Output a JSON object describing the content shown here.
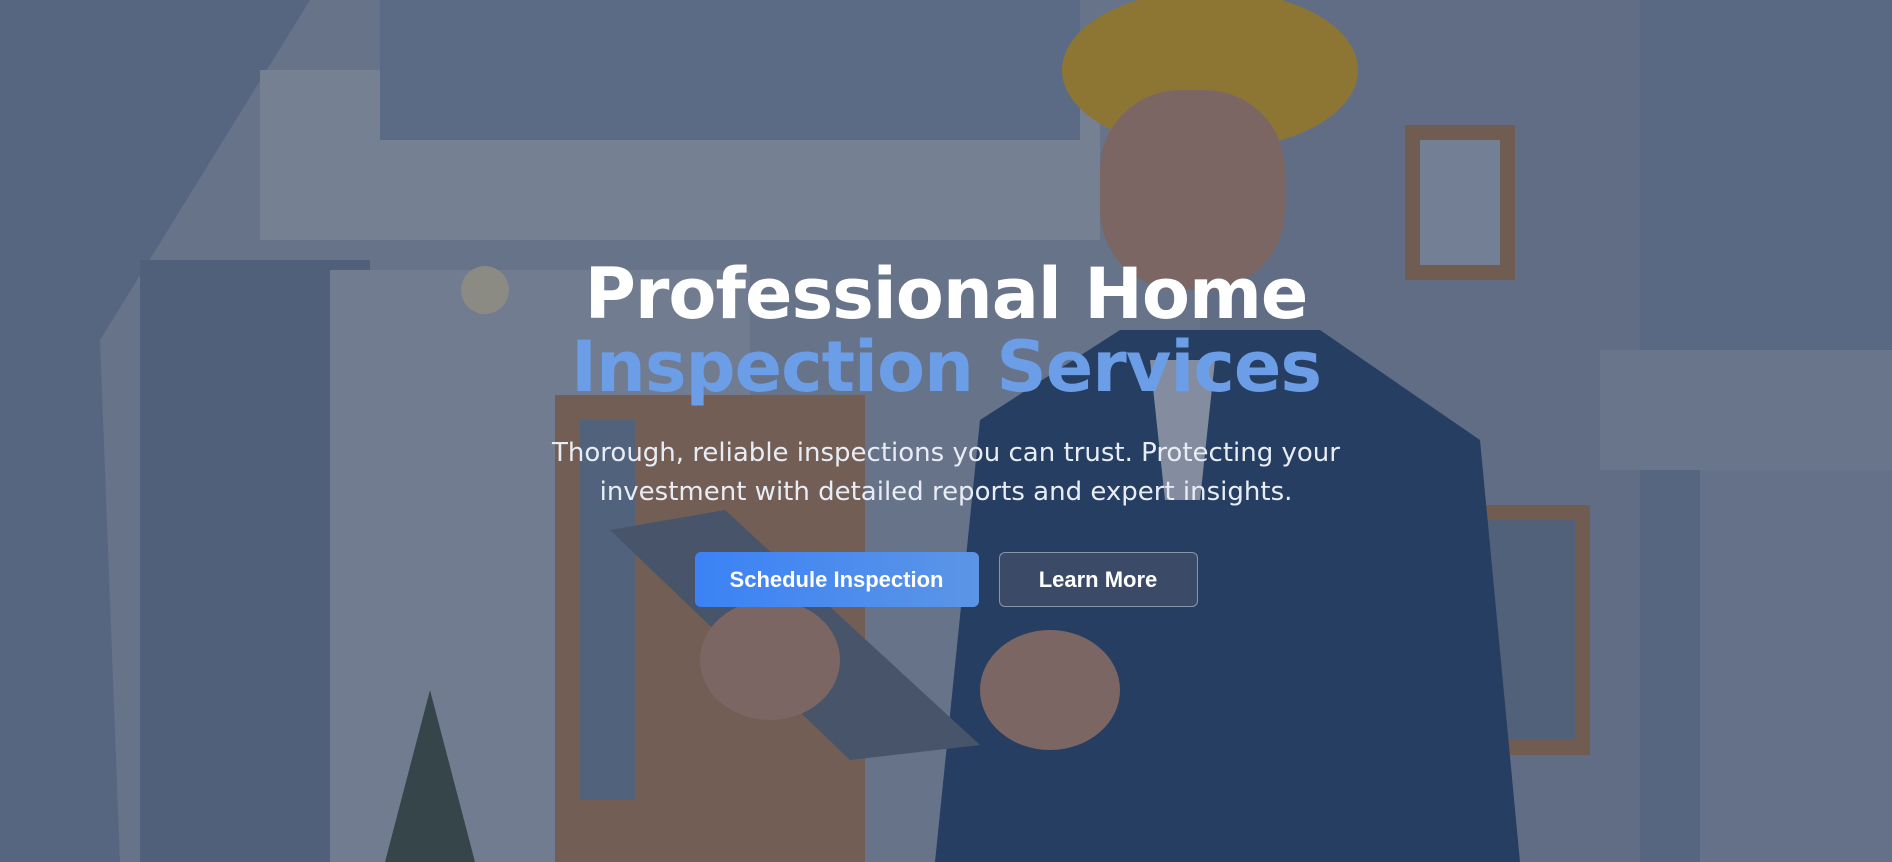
{
  "hero": {
    "title_line1": "Professional Home",
    "title_line2": "Inspection Services",
    "subtitle": "Thorough, reliable inspections you can trust. Protecting your investment with detailed reports and expert insights.",
    "background_image": "home-inspector-photo",
    "accent_color": "#6c9ee8",
    "primary_button": {
      "label": "Schedule Inspection",
      "color": "#3b82f6"
    },
    "secondary_button": {
      "label": "Learn More"
    }
  }
}
